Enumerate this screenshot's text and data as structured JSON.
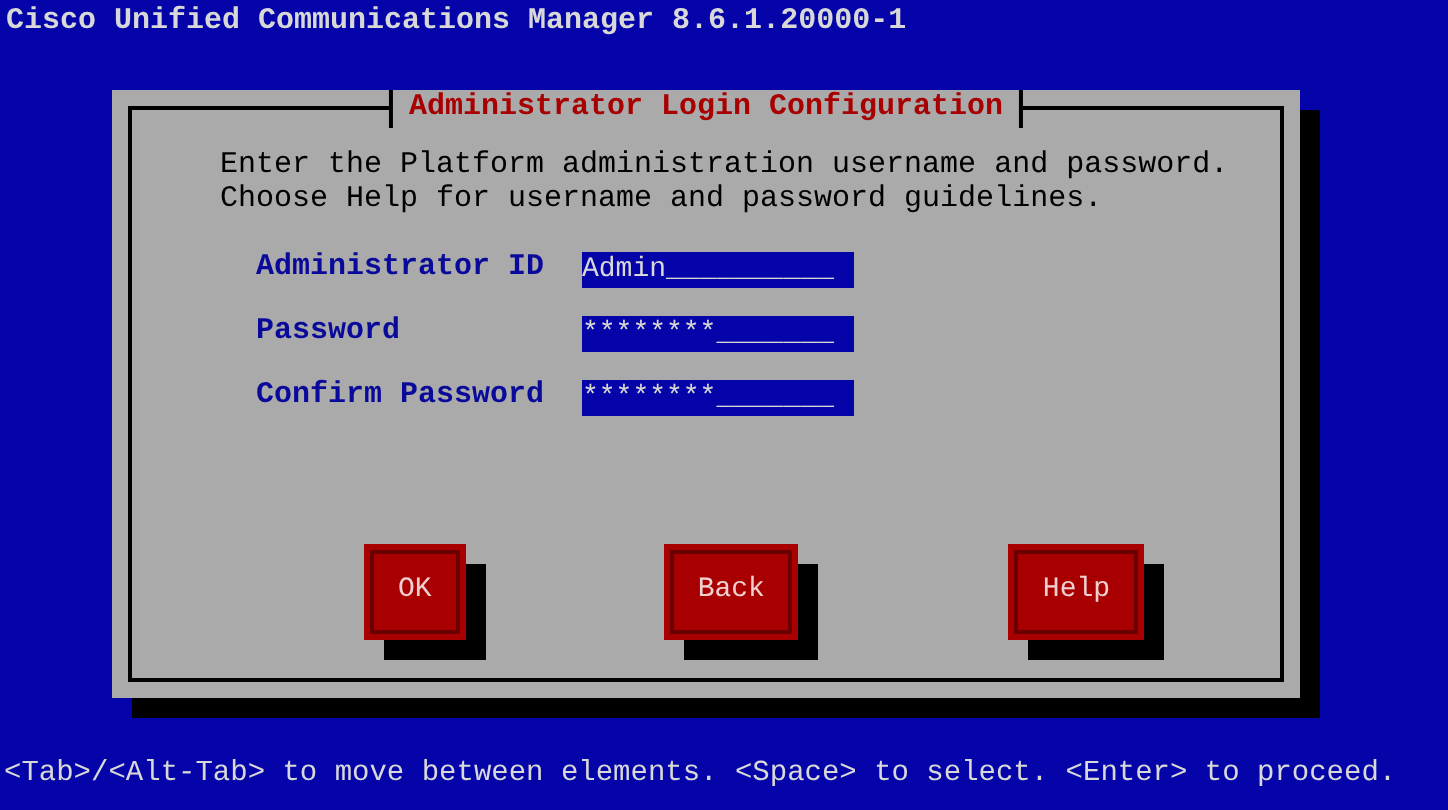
{
  "window": {
    "title": "Cisco Unified Communications Manager 8.6.1.20000-1"
  },
  "dialog": {
    "title": "Administrator Login Configuration",
    "instructions": [
      "Enter the Platform administration username and password.",
      "Choose Help for username and password guidelines."
    ],
    "fields": [
      {
        "label": "Administrator ID",
        "value": "Admin__________"
      },
      {
        "label": "Password",
        "value": "********_______"
      },
      {
        "label": "Confirm Password",
        "value": "********_______"
      }
    ],
    "buttons": [
      "OK",
      "Back",
      "Help"
    ]
  },
  "status_bar": "<Tab>/<Alt-Tab> to move between elements. <Space> to select. <Enter> to proceed."
}
